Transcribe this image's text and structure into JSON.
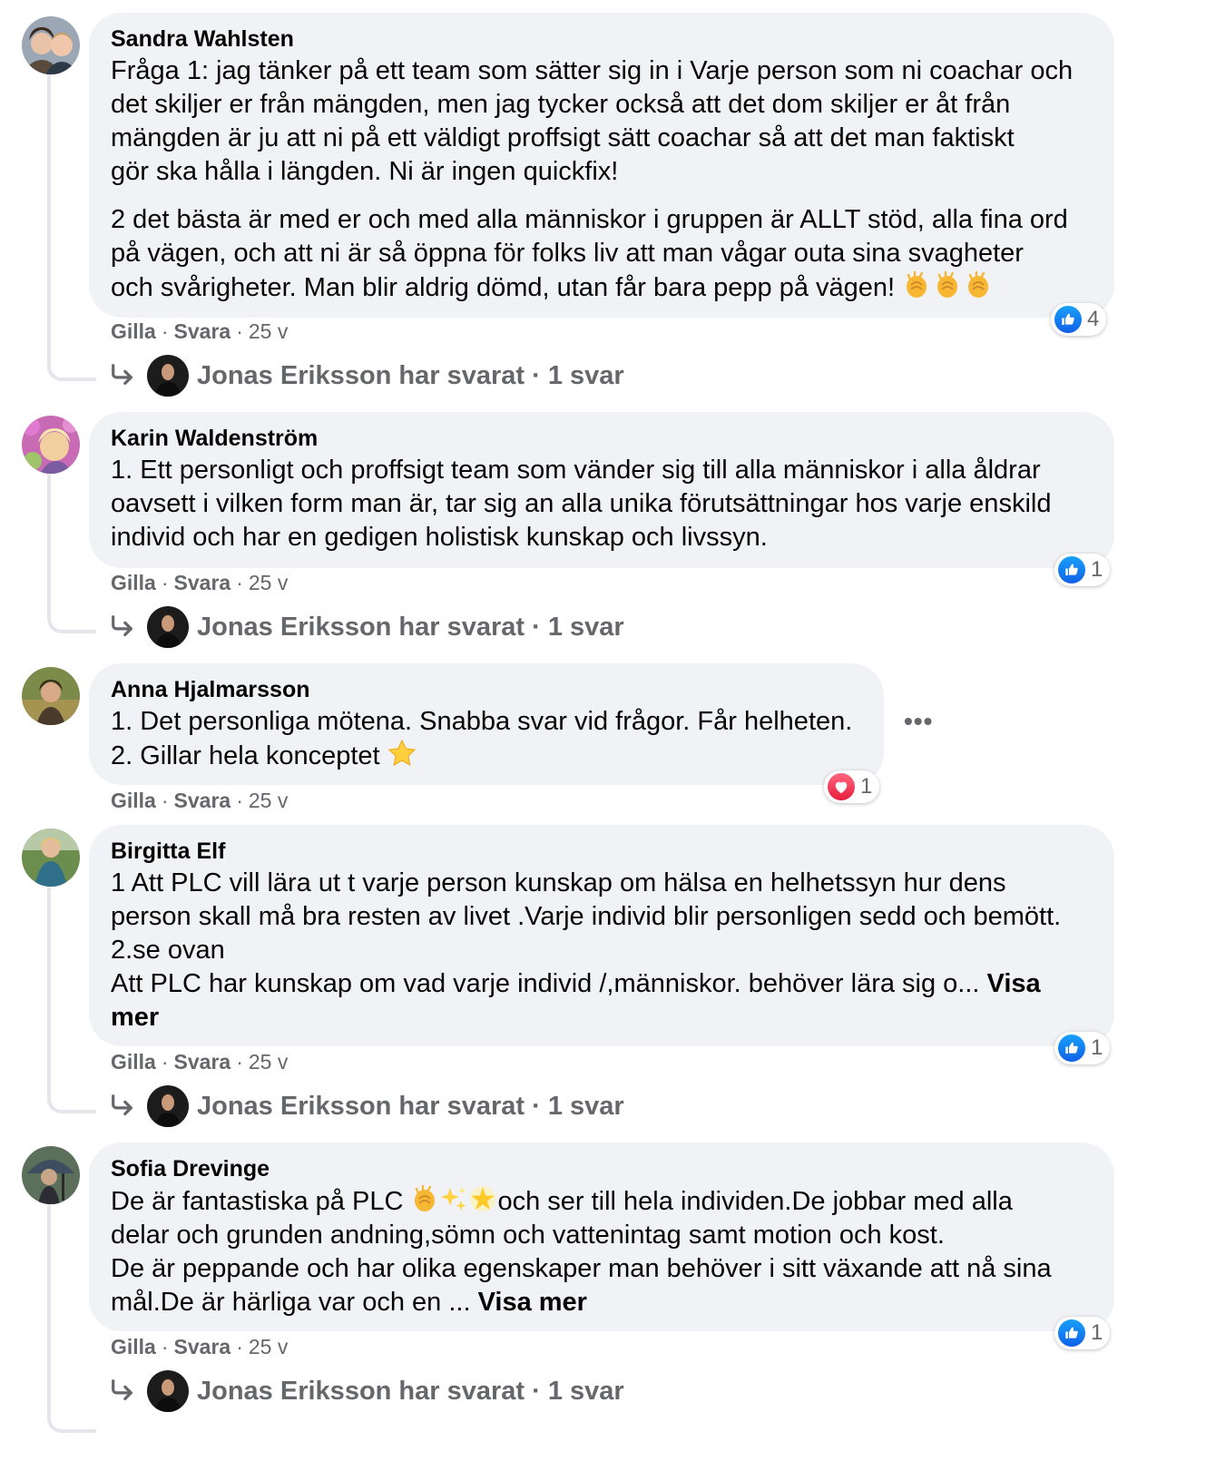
{
  "common": {
    "like_label": "Gilla",
    "reply_label": "Svara",
    "time": "25 v",
    "reply_author": "Jonas Eriksson har svarat",
    "reply_count": "1 svar",
    "see_more": "Visa mer"
  },
  "comments": [
    {
      "author": "Sandra Wahlsten",
      "lines": [
        "Fråga 1: jag tänker på ett team som sätter sig in i Varje person som ni coachar och",
        "det skiljer er från mängden, men jag tycker också att det dom skiljer er åt från",
        "mängden är ju att ni på ett väldigt proffsigt sätt coachar så att det man faktiskt",
        "gör ska hålla i längden. Ni är ingen quickfix!"
      ],
      "lines2": [
        "2 det bästa är med er och med alla människor i gruppen är ALLT stöd, alla fina ord",
        "på vägen, och att ni är så öppna för folks liv att man vågar outa sina svagheter",
        "och svårigheter. Man blir aldrig dömd, utan får bara pepp på vägen!"
      ],
      "reaction_type": "like",
      "reaction_count": "4"
    },
    {
      "author": "Karin Waldenström",
      "lines": [
        "1. Ett personligt och proffsigt team som vänder sig till alla människor i alla åldrar",
        "oavsett i vilken form man är, tar sig an alla unika förutsättningar hos varje enskild",
        "individ och har en gedigen holistisk kunskap och livssyn."
      ],
      "reaction_type": "like",
      "reaction_count": "1"
    },
    {
      "author": "Anna Hjalmarsson",
      "lines": [
        "1. Det personliga mötena. Snabba svar vid frågor. Får helheten.",
        "2. Gillar hela konceptet"
      ],
      "reaction_type": "love",
      "reaction_count": "1"
    },
    {
      "author": "Birgitta Elf",
      "lines": [
        "1 Att PLC vill lära ut t varje person kunskap om hälsa en helhetssyn hur dens",
        "person skall må bra resten av livet .Varje individ blir personligen sedd och bemött.",
        "2.se ovan",
        "Att PLC har kunskap om vad varje individ /,människor. behöver lära sig o..."
      ],
      "reaction_type": "like",
      "reaction_count": "1"
    },
    {
      "author": "Sofia Drevinge",
      "lines": [
        "De är fantastiska på PLC",
        "och ser till hela individen.De jobbar med alla",
        "delar och grunden andning,sömn och vattenintag samt motion och kost.",
        "De är peppande och har olika egenskaper man behöver i sitt växande att nå sina",
        "mål.De är härliga var och en ..."
      ],
      "reaction_type": "like",
      "reaction_count": "1"
    }
  ]
}
